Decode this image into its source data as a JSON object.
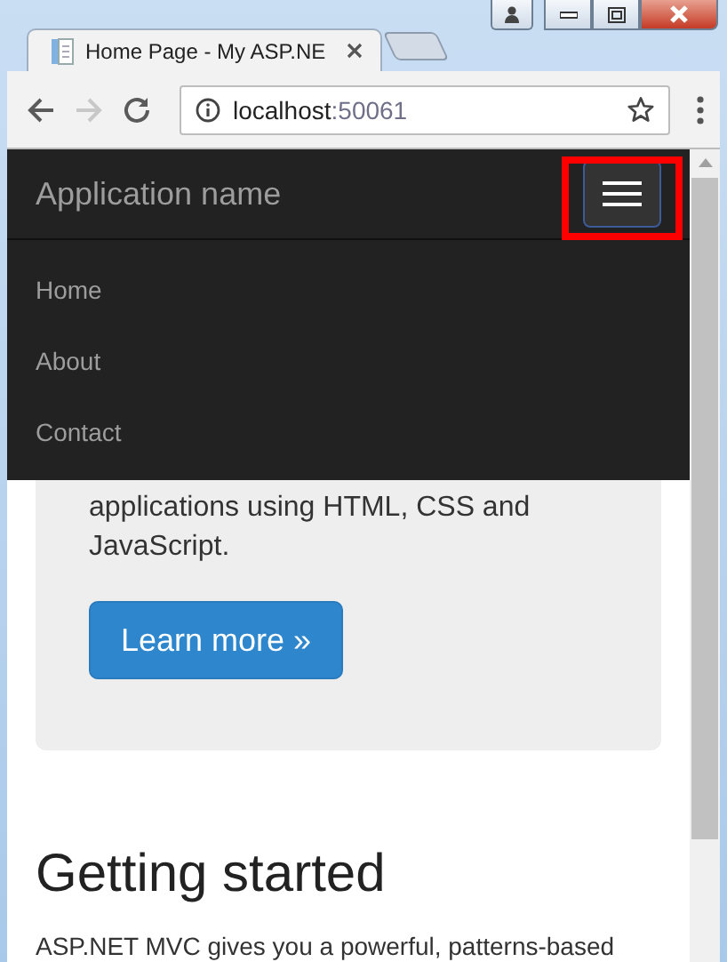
{
  "browser": {
    "tab": {
      "title": "Home Page - My ASP.NE"
    },
    "nav_buttons": [
      {
        "kind": "back",
        "disabled": false
      },
      {
        "kind": "forward",
        "disabled": true
      },
      {
        "kind": "reload",
        "disabled": false
      }
    ],
    "address": {
      "host": "localhost",
      "port": ":50061"
    }
  },
  "navbar": {
    "brand": "Application name",
    "menu_expanded": true,
    "highlighted": true,
    "items": [
      {
        "label": "Home"
      },
      {
        "label": "About"
      },
      {
        "label": "Contact"
      }
    ]
  },
  "jumbotron": {
    "text": "applications using HTML, CSS and JavaScript.",
    "button": "Learn more »"
  },
  "section": {
    "heading": "Getting started",
    "text": "ASP.NET MVC gives you a powerful, patterns-based"
  }
}
